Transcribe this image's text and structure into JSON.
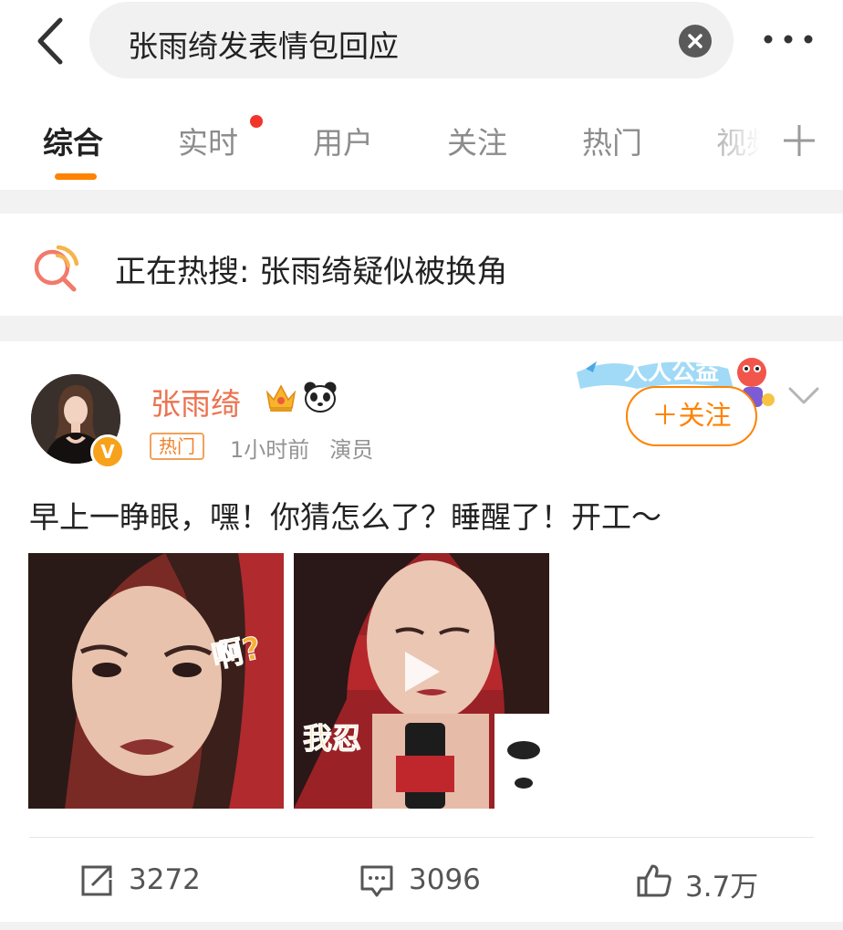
{
  "search": {
    "query": "张雨绮发表情包回应"
  },
  "tabs": [
    {
      "label": "综合",
      "active": true
    },
    {
      "label": "实时",
      "dot": true
    },
    {
      "label": "用户"
    },
    {
      "label": "关注"
    },
    {
      "label": "热门"
    },
    {
      "label": "视频"
    }
  ],
  "hot_search": {
    "text": "正在热搜: 张雨绮疑似被换角"
  },
  "post": {
    "author": "张雨绮",
    "verified_badge": "V",
    "tag": "热门",
    "time": "1小时前",
    "role": "演员",
    "follow_label": "＋关注",
    "banner_text": "人人公益",
    "text": "早上一睁眼，嘿！你猜怎么了？睡醒了！开工～",
    "images": [
      {
        "caption": "啊?"
      },
      {
        "caption": "我忍"
      }
    ],
    "reposts": "3272",
    "comments": "3096",
    "likes": "3.7万"
  },
  "colors": {
    "accent": "#ff8200",
    "username": "#eb7350",
    "unread_dot": "#f2352b"
  }
}
